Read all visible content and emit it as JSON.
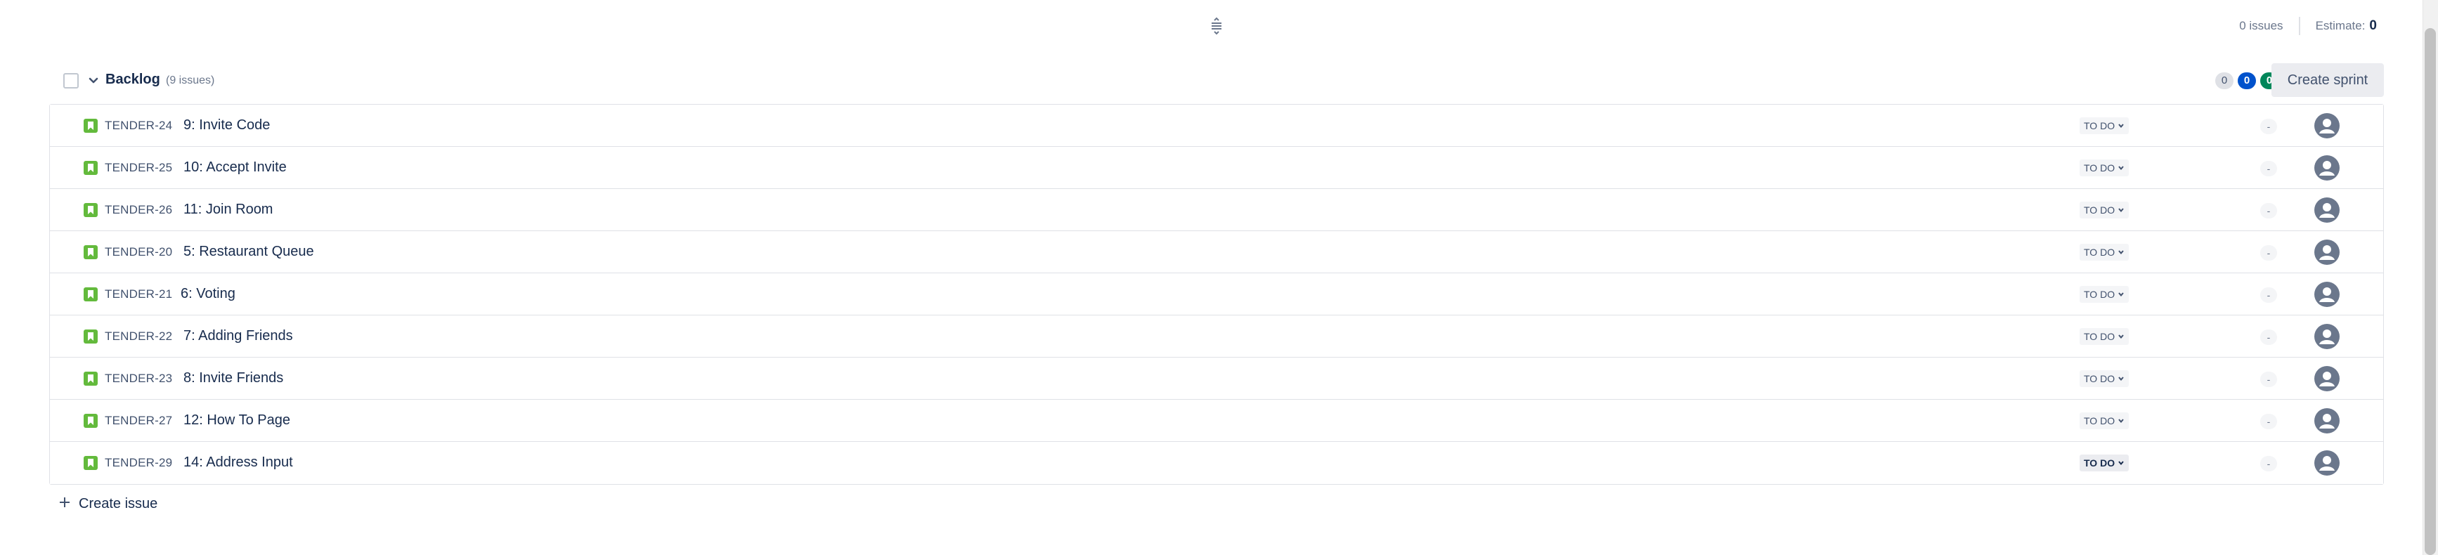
{
  "top": {
    "issues_text": "0 issues",
    "estimate_label": "Estimate:",
    "estimate_value": "0"
  },
  "backlog": {
    "title": "Backlog",
    "count_text": "(9 issues)",
    "badge_todo": "0",
    "badge_in_progress": "0",
    "badge_done": "0",
    "create_sprint_label": "Create sprint"
  },
  "issues": [
    {
      "key": "TENDER-24",
      "summary": "9: Invite Code",
      "status": "TO DO",
      "estimate": "-"
    },
    {
      "key": "TENDER-25",
      "summary": "10: Accept Invite",
      "status": "TO DO",
      "estimate": "-"
    },
    {
      "key": "TENDER-26",
      "summary": "11: Join Room",
      "status": "TO DO",
      "estimate": "-"
    },
    {
      "key": "TENDER-20",
      "summary": "5: Restaurant Queue",
      "status": "TO DO",
      "estimate": "-"
    },
    {
      "key": "TENDER-21",
      "summary": "6: Voting",
      "status": "TO DO",
      "estimate": "-"
    },
    {
      "key": "TENDER-22",
      "summary": "7: Adding Friends",
      "status": "TO DO",
      "estimate": "-"
    },
    {
      "key": "TENDER-23",
      "summary": "8: Invite Friends",
      "status": "TO DO",
      "estimate": "-"
    },
    {
      "key": "TENDER-27",
      "summary": "12: How To Page",
      "status": "TO DO",
      "estimate": "-"
    },
    {
      "key": "TENDER-29",
      "summary": "14: Address Input",
      "status": "TO DO",
      "estimate": "-"
    }
  ],
  "create_issue_label": "Create issue",
  "icons": {
    "drag": "drag-handle-icon",
    "chevron": "chevron-down-icon",
    "story": "story-icon",
    "avatar": "avatar-icon",
    "plus": "plus-icon"
  },
  "colors": {
    "story_green": "#63ba3c",
    "in_progress_blue": "#0052cc",
    "done_green": "#00875a"
  }
}
